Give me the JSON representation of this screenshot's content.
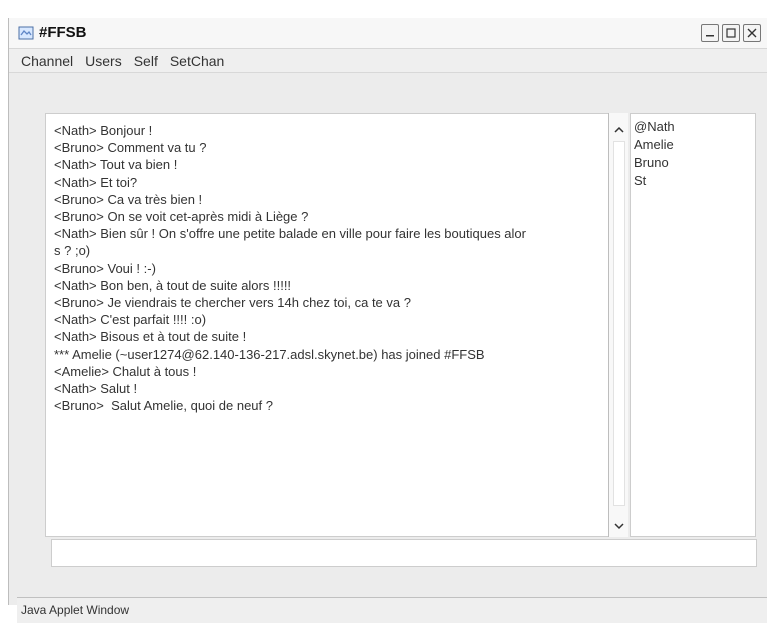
{
  "window": {
    "title": "#FFSB"
  },
  "menu": {
    "items": [
      "Channel",
      "Users",
      "Self",
      "SetChan"
    ]
  },
  "chat": {
    "messages": [
      "<Nath> Bonjour !",
      "<Bruno> Comment va tu ?",
      "<Nath> Tout va bien !",
      "<Nath> Et toi?",
      "<Bruno> Ca va très bien !",
      "<Bruno> On se voit cet-après midi à Liège ?",
      "<Nath> Bien sûr ! On s'offre une petite balade en ville pour faire les boutiques alor",
      "s ? ;o)",
      "<Bruno> Voui ! :-)",
      "<Nath> Bon ben, à tout de suite alors !!!!!",
      "<Bruno> Je viendrais te chercher vers 14h chez toi, ca te va ?",
      "<Nath> C'est parfait !!!! :o)",
      "<Nath> Bisous et à tout de suite !",
      "*** Amelie (~user1274@62.140-136-217.adsl.skynet.be) has joined #FFSB",
      "<Amelie> Chalut à tous !",
      "<Nath> Salut !",
      "<Bruno>  Salut Amelie, quoi de neuf ?"
    ]
  },
  "users": {
    "items": [
      "@Nath",
      "Amelie",
      "Bruno",
      "St"
    ]
  },
  "input": {
    "value": ""
  },
  "status": {
    "text": "Java Applet Window"
  },
  "icons": {
    "app": "app-icon",
    "minimize": "minimize-icon",
    "maximize": "maximize-icon",
    "close": "close-icon",
    "scroll_up": "scroll-up-icon",
    "scroll_down": "scroll-down-icon"
  }
}
